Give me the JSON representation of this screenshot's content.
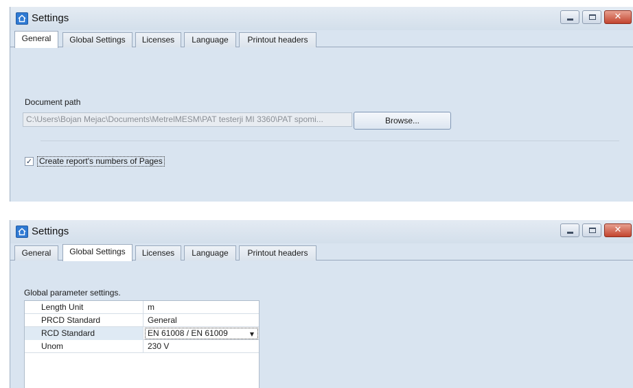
{
  "windows": [
    {
      "title": "Settings",
      "tabs": [
        "General",
        "Global Settings",
        "Licenses",
        "Language",
        "Printout headers"
      ],
      "active_tab": "General",
      "general": {
        "document_path_label": "Document path",
        "document_path_value": "C:\\Users\\Bojan Mejac\\Documents\\MetrelMESM\\PAT testerji MI 3360\\PAT spomi...",
        "browse_label": "Browse...",
        "create_report_pages": {
          "label": "Create report's numbers of Pages",
          "checked": true
        }
      }
    },
    {
      "title": "Settings",
      "tabs": [
        "General",
        "Global Settings",
        "Licenses",
        "Language",
        "Printout headers"
      ],
      "active_tab": "Global Settings",
      "global_settings": {
        "heading": "Global parameter settings.",
        "rows": [
          {
            "name": "Length Unit",
            "value": "m"
          },
          {
            "name": "PRCD Standard",
            "value": "General"
          },
          {
            "name": "RCD Standard",
            "value": "EN 61008 / EN 61009"
          },
          {
            "name": "Unom",
            "value": "230 V"
          }
        ]
      }
    }
  ],
  "icons": {
    "window": "home-icon",
    "minimize": "minimize-icon",
    "maximize": "maximize-icon",
    "close": "close-icon",
    "checkbox": "checkmark-icon",
    "dropdown": "chevron-down-icon"
  },
  "colors": {
    "window_bg": "#d9e4f0",
    "close_button": "#c2442e",
    "accent_icon": "#2f7ad3"
  }
}
